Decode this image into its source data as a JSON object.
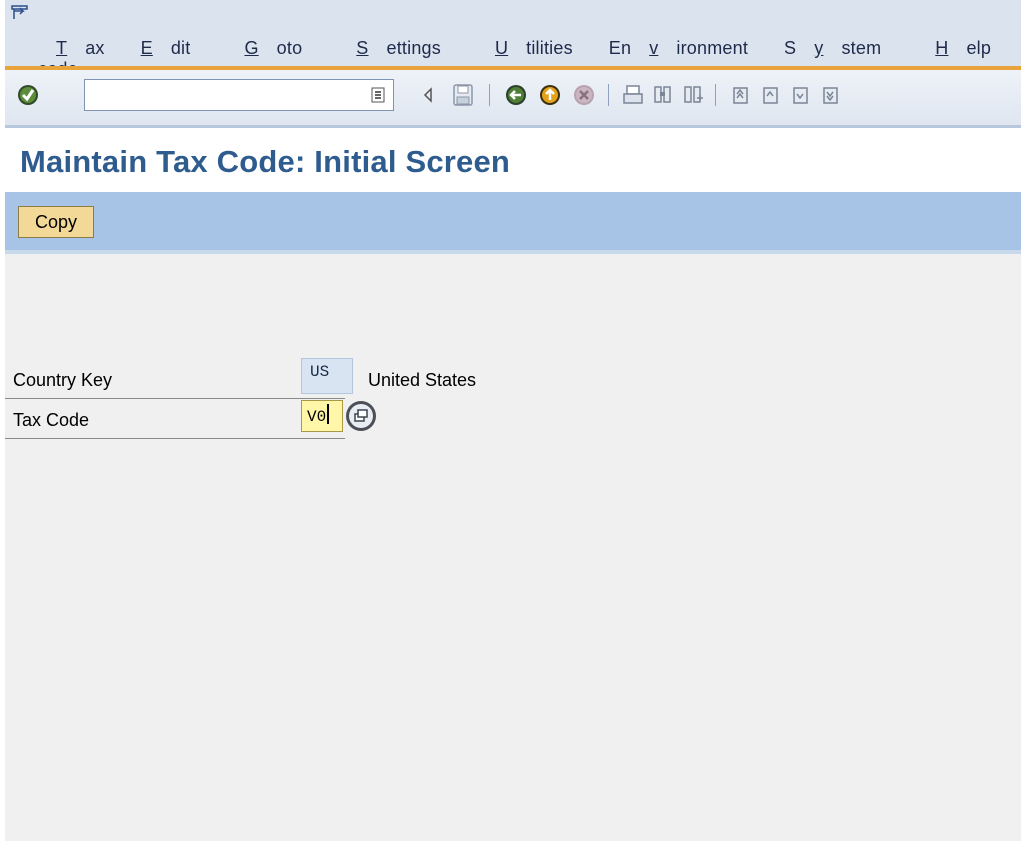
{
  "menu": {
    "items": [
      {
        "pre": "",
        "ul": "T",
        "post": "ax code"
      },
      {
        "pre": "",
        "ul": "E",
        "post": "dit"
      },
      {
        "pre": "",
        "ul": "G",
        "post": "oto"
      },
      {
        "pre": "",
        "ul": "S",
        "post": "ettings"
      },
      {
        "pre": "",
        "ul": "U",
        "post": "tilities"
      },
      {
        "pre": "En",
        "ul": "v",
        "post": "ironment"
      },
      {
        "pre": "S",
        "ul": "y",
        "post": "stem"
      },
      {
        "pre": "",
        "ul": "H",
        "post": "elp"
      }
    ]
  },
  "toolbar": {
    "command_value": "",
    "icons": [
      "enter-icon",
      "command-history-icon",
      "back-arrow-icon",
      "save-icon",
      "back-icon",
      "exit-icon",
      "cancel-icon",
      "print-icon",
      "find-icon",
      "find-next-icon",
      "first-page-icon",
      "previous-page-icon",
      "next-page-icon",
      "last-page-icon"
    ]
  },
  "title": "Maintain Tax Code: Initial Screen",
  "app_toolbar": {
    "copy_label": "Copy"
  },
  "form": {
    "country_key_label": "Country Key",
    "country_key_value": "US",
    "country_name": "United States",
    "tax_code_label": "Tax Code",
    "tax_code_value": "V0"
  },
  "colors": {
    "title": "#2e5c8e",
    "app_toolbar_bg": "#a7c4e6",
    "menu_bg": "#dbe3ef",
    "accent_line": "#e8a33a",
    "copy_button_bg": "#f2d998",
    "required_field_bg": "#fff6a8"
  }
}
